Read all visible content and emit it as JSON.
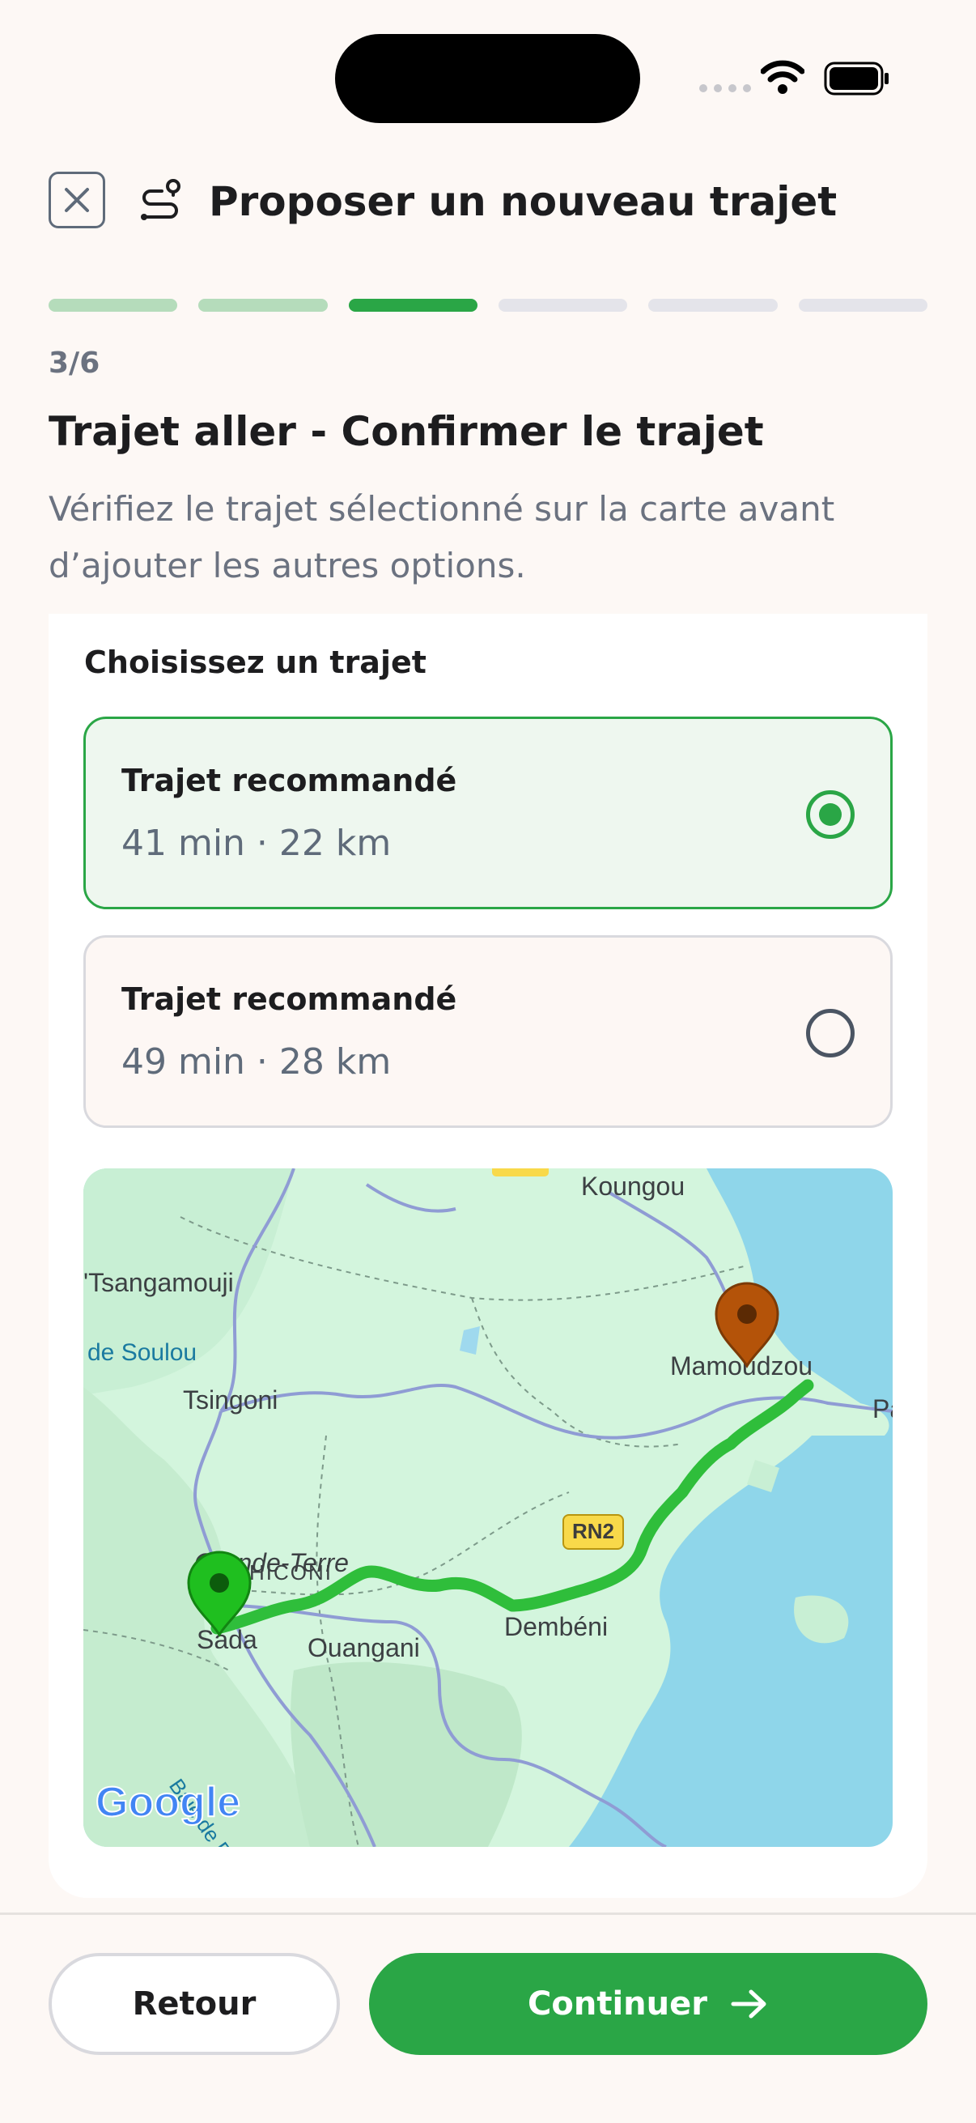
{
  "header": {
    "title": "Proposer un nouveau trajet"
  },
  "progress": {
    "step_label": "3/6",
    "current": 3,
    "total": 6
  },
  "section": {
    "heading": "Trajet aller - Confirmer le trajet",
    "description": "Vérifiez le trajet sélectionné sur la carte avant d’ajouter les autres options."
  },
  "routes": {
    "label": "Choisissez un trajet",
    "options": [
      {
        "title": "Trajet recommandé",
        "meta": "41 min · 22 km",
        "selected": true
      },
      {
        "title": "Trajet recommandé",
        "meta": "49 min · 28 km",
        "selected": false
      }
    ]
  },
  "map": {
    "places": {
      "koungou": "Koungou",
      "tsangamouji": "'Tsangamouji",
      "soulou": "de Soulou",
      "mamoudzou": "Mamoudzou",
      "pa": "Pa",
      "tsingoni": "Tsingoni",
      "grande_terre": "Grande-Terre",
      "hiconi": "HICONI",
      "sada": "Sada",
      "ouangani": "Ouangani",
      "dembeni": "Dembéni",
      "baie": "Baie de B"
    },
    "road_label": "RN2",
    "attribution": "Google",
    "colors": {
      "route": "#2fbe3b",
      "start_pin": "#1fbf1f",
      "end_pin": "#b45309"
    }
  },
  "footer": {
    "back_label": "Retour",
    "next_label": "Continuer"
  },
  "colors": {
    "accent": "#2aa646",
    "background": "#fdf8f5"
  }
}
